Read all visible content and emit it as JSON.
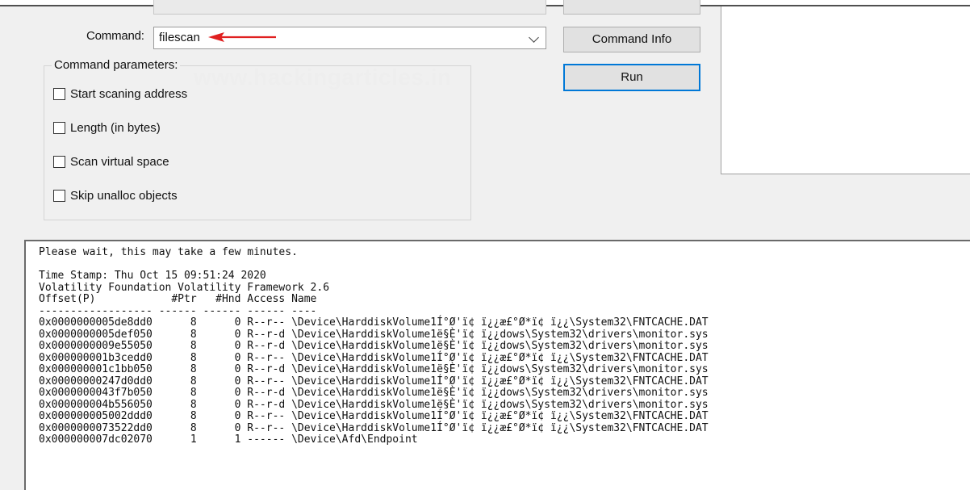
{
  "command": {
    "label": "Command:",
    "value": "filescan",
    "info_button": "Command Info",
    "run_button": "Run"
  },
  "parameters": {
    "title": "Command parameters:",
    "watermark": "www.hackingarticles.in",
    "options": [
      {
        "label": "Start scaning address",
        "checked": false
      },
      {
        "label": "Length (in bytes)",
        "checked": false
      },
      {
        "label": "Scan virtual space",
        "checked": false
      },
      {
        "label": "Skip unalloc objects",
        "checked": false
      }
    ]
  },
  "annotation": {
    "arrow_color": "#e02020"
  },
  "output": {
    "lines": [
      "Please wait, this may take a few minutes.",
      "",
      "Time Stamp: Thu Oct 15 09:51:24 2020",
      "Volatility Foundation Volatility Framework 2.6",
      "Offset(P)            #Ptr   #Hnd Access Name",
      "------------------ ------ ------ ------ ----",
      "0x0000000005de8dd0      8      0 R--r-- \\Device\\HarddiskVolume1Í°Ø'ï¢ ï¿¿æ£°Ø*ï¢ ï¿¿\\System32\\FNTCACHE.DAT",
      "0x0000000005def050      8      0 R--r-d \\Device\\HarddiskVolume1ë§È'ï¢ ï¿¿dows\\System32\\drivers\\monitor.sys",
      "0x0000000009e55050      8      0 R--r-d \\Device\\HarddiskVolume1ë§È'ï¢ ï¿¿dows\\System32\\drivers\\monitor.sys",
      "0x000000001b3cedd0      8      0 R--r-- \\Device\\HarddiskVolume1Í°Ø'ï¢ ï¿¿æ£°Ø*ï¢ ï¿¿\\System32\\FNTCACHE.DAT",
      "0x000000001c1bb050      8      0 R--r-d \\Device\\HarddiskVolume1ë§È'ï¢ ï¿¿dows\\System32\\drivers\\monitor.sys",
      "0x00000000247d0dd0      8      0 R--r-- \\Device\\HarddiskVolume1Í°Ø'ï¢ ï¿¿æ£°Ø*ï¢ ï¿¿\\System32\\FNTCACHE.DAT",
      "0x0000000043f7b050      8      0 R--r-d \\Device\\HarddiskVolume1ë§È'ï¢ ï¿¿dows\\System32\\drivers\\monitor.sys",
      "0x000000004b556050      8      0 R--r-d \\Device\\HarddiskVolume1ë§È'ï¢ ï¿¿dows\\System32\\drivers\\monitor.sys",
      "0x000000005002ddd0      8      0 R--r-- \\Device\\HarddiskVolume1Í°Ø'ï¢ ï¿¿æ£°Ø*ï¢ ï¿¿\\System32\\FNTCACHE.DAT",
      "0x0000000073522dd0      8      0 R--r-- \\Device\\HarddiskVolume1Í°Ø'ï¢ ï¿¿æ£°Ø*ï¢ ï¿¿\\System32\\FNTCACHE.DAT",
      "0x000000007dc02070      1      1 ------ \\Device\\Afd\\Endpoint"
    ]
  }
}
